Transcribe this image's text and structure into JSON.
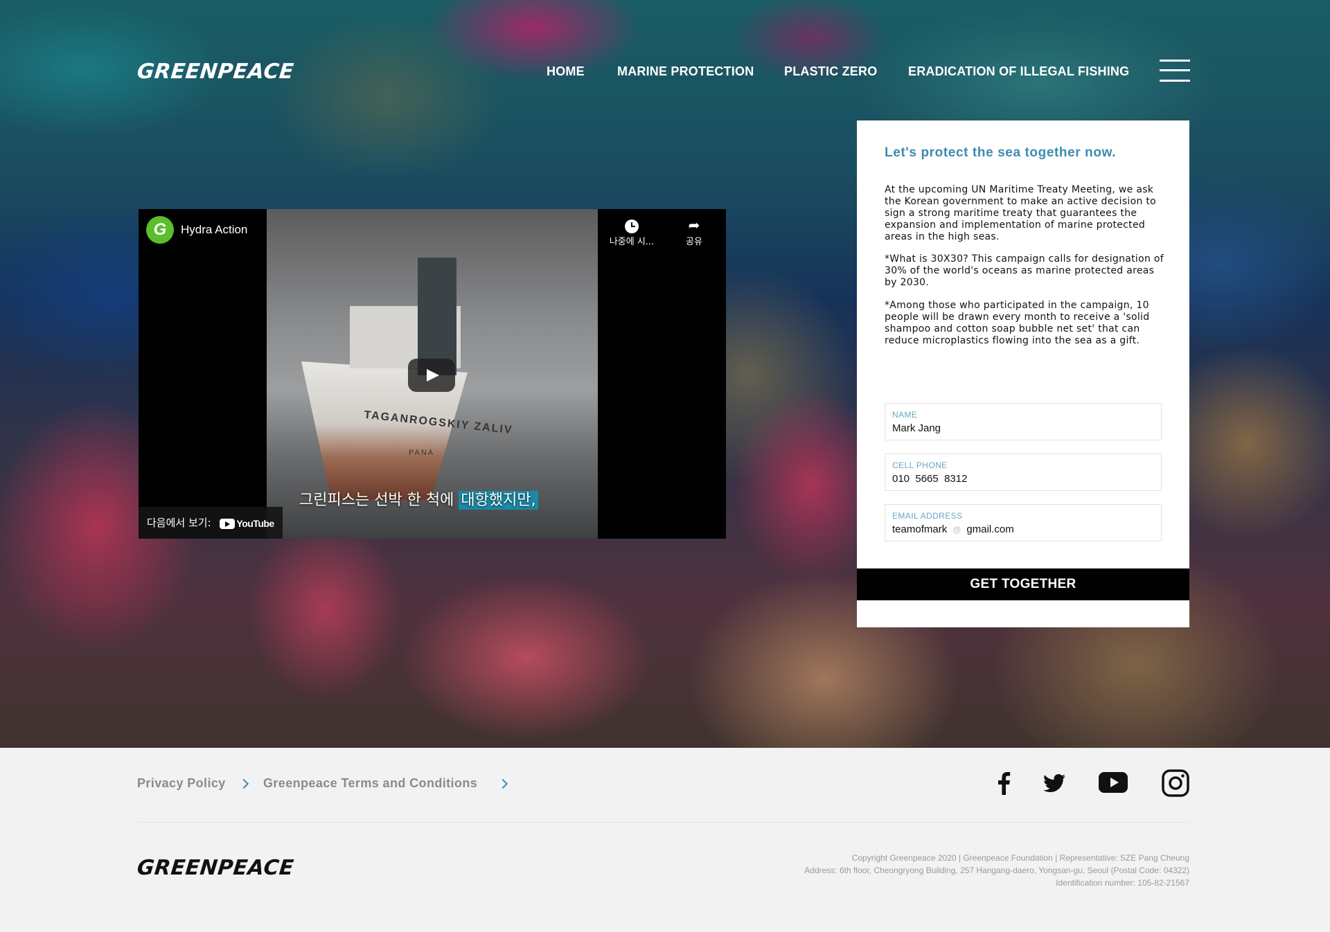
{
  "header": {
    "logo": "GREENPEACE",
    "nav": [
      "HOME",
      "MARINE PROTECTION",
      "PLASTIC ZERO",
      "ERADICATION OF ILLEGAL FISHING"
    ]
  },
  "video": {
    "channel_initial": "G",
    "channel_name": "Hydra Action",
    "watch_later": "나중에 시...",
    "share": "공유",
    "ship_name": "TAGANROGSKIY ZALIV",
    "ship_port": "PANA",
    "subtitle_plain": "그린피스는 선박 한 척에 ",
    "subtitle_highlight": "대항했지만,",
    "watch_on": "다음에서 보기:",
    "youtube": "YouTube"
  },
  "form": {
    "title": "Let's protect the sea together now.",
    "paragraphs": [
      "At the upcoming UN Maritime Treaty Meeting, we ask the Korean government to make an active decision to sign a strong maritime treaty that guarantees the expansion and implementation of marine protected areas in the high seas.",
      "*What is 30X30? This campaign calls for designation of 30% of the world's oceans as marine protected areas by 2030.",
      "*Among those who participated in the campaign, 10 people will be drawn every month to receive a 'solid shampoo and cotton soap bubble net set' that can reduce microplastics flowing into the sea as a gift."
    ],
    "fields": {
      "name_label": "NAME",
      "name_value": "Mark Jang",
      "phone_label": "CELL PHONE",
      "phone_value": "010  5665  8312",
      "email_label": "EMAIL ADDRESS",
      "email_user": "teamofmark",
      "email_at": "@",
      "email_domain": "gmail.com"
    },
    "cta": "GET TOGETHER"
  },
  "footer": {
    "links": [
      "Privacy Policy",
      "Greenpeace Terms and Conditions"
    ],
    "social": [
      "facebook-icon",
      "twitter-icon",
      "youtube-icon",
      "instagram-icon"
    ],
    "logo": "GREENPEACE",
    "legal": [
      "Copyright Greenpeace 2020 | Greenpeace Foundation | Representative: SZE Pang Cheung",
      "Address: 6th floor, Cheongryong Building, 257 Hangang-daero, Yongsan-gu, Seoul (Postal Code: 04322)",
      "Identification number: 105-82-21567"
    ]
  },
  "colors": {
    "accent": "#3b8bb0",
    "cta_bg": "#000000",
    "footer_bg": "#f2f2f2",
    "subtitle_highlight": "#1a8aa6",
    "channel_green": "#5cbd2d"
  }
}
